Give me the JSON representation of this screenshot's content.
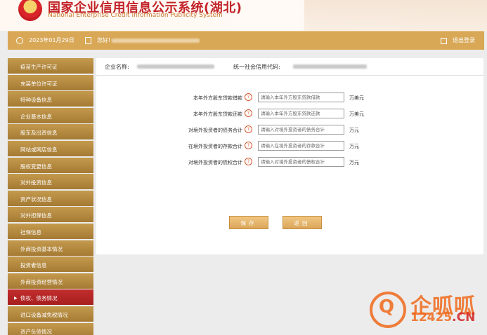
{
  "header": {
    "title_cn": "国家企业信用信息公示系统(湖北)",
    "title_en": "National Enterprise Credit Information Publicity System"
  },
  "topbar": {
    "date": "2023年01月29日",
    "greeting": "您好!",
    "logout": "退出登录"
  },
  "sidebar": {
    "items": [
      {
        "label": "疫苗生产许可证",
        "active": false
      },
      {
        "label": "充装单位许可证",
        "active": false
      },
      {
        "label": "特种设备信息",
        "active": false
      },
      {
        "label": "企业基本信息",
        "active": false
      },
      {
        "label": "股东及出资信息",
        "active": false
      },
      {
        "label": "网站或网店信息",
        "active": false
      },
      {
        "label": "股权变更信息",
        "active": false
      },
      {
        "label": "对外投资信息",
        "active": false
      },
      {
        "label": "资产状况信息",
        "active": false
      },
      {
        "label": "对外担保信息",
        "active": false
      },
      {
        "label": "社保信息",
        "active": false
      },
      {
        "label": "外商投资基本情况",
        "active": false
      },
      {
        "label": "投资者信息",
        "active": false
      },
      {
        "label": "外商投资经营情况",
        "active": false
      },
      {
        "label": "债权、债务情况",
        "active": true
      },
      {
        "label": "进口设备减免税情况",
        "active": false
      },
      {
        "label": "资产负债情况",
        "active": false
      }
    ]
  },
  "company": {
    "name_label": "企业名称:",
    "credit_code_label": "统一社会信用代码:"
  },
  "form": {
    "rows": [
      {
        "label": "本年外方股东贷款借款",
        "placeholder": "请输入本年外方股东贷款借款",
        "unit": "万美元"
      },
      {
        "label": "本年外方股东贷款还款",
        "placeholder": "请输入本年外方股东贷款还款",
        "unit": "万美元"
      },
      {
        "label": "对境外投资者的债务合计",
        "placeholder": "请输入对境外投资者的债务合计",
        "unit": "万元"
      },
      {
        "label": "在境外投资者的存款合计",
        "placeholder": "请输入在境外投资者的存款合计",
        "unit": "万元"
      },
      {
        "label": "对境外投资者的债权合计",
        "placeholder": "请输入对境外投资者的债权合计",
        "unit": "万元"
      }
    ],
    "help_glyph": "?",
    "save_label": "保存",
    "back_label": "返回"
  },
  "watermark": {
    "brand": "企呱呱",
    "domain_num": "12425",
    "domain_tld": ".CN",
    "accent_color": "#f06a1c"
  }
}
